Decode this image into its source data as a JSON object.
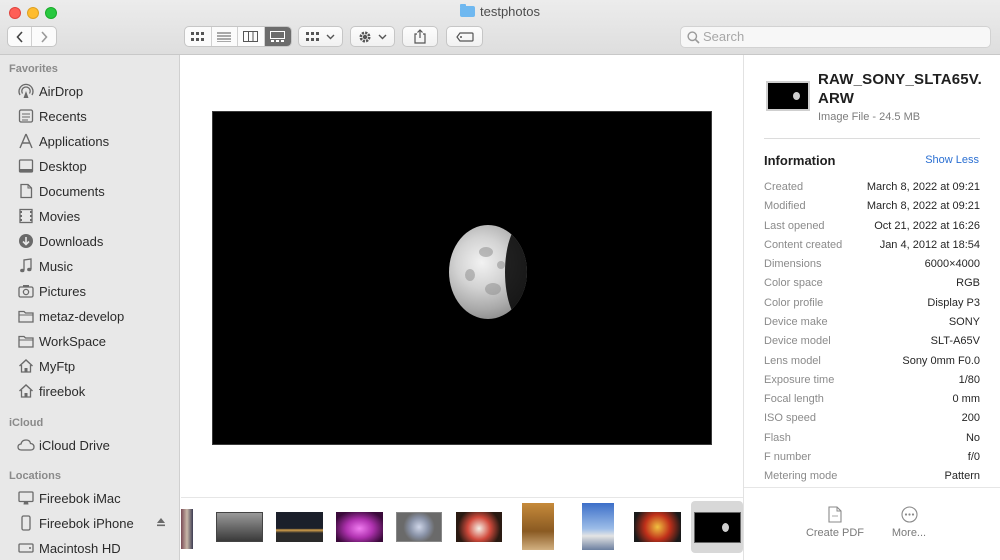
{
  "window": {
    "title": "testphotos"
  },
  "toolbar": {
    "search_placeholder": "Search"
  },
  "sidebar": {
    "favorites_label": "Favorites",
    "favorites": [
      {
        "label": "AirDrop",
        "icon": "airdrop-icon"
      },
      {
        "label": "Recents",
        "icon": "recents-icon"
      },
      {
        "label": "Applications",
        "icon": "applications-icon"
      },
      {
        "label": "Desktop",
        "icon": "desktop-icon"
      },
      {
        "label": "Documents",
        "icon": "documents-icon"
      },
      {
        "label": "Movies",
        "icon": "movies-icon"
      },
      {
        "label": "Downloads",
        "icon": "downloads-icon"
      },
      {
        "label": "Music",
        "icon": "music-icon"
      },
      {
        "label": "Pictures",
        "icon": "pictures-icon"
      },
      {
        "label": "metaz-develop",
        "icon": "folder-icon"
      },
      {
        "label": "WorkSpace",
        "icon": "folder-icon"
      },
      {
        "label": "MyFtp",
        "icon": "home-icon"
      },
      {
        "label": "fireebok",
        "icon": "home-icon"
      }
    ],
    "icloud_label": "iCloud",
    "icloud": [
      {
        "label": "iCloud Drive",
        "icon": "cloud-icon"
      }
    ],
    "locations_label": "Locations",
    "locations": [
      {
        "label": "Fireebok iMac",
        "icon": "imac-icon"
      },
      {
        "label": "Fireebok iPhone",
        "icon": "iphone-icon"
      },
      {
        "label": "Macintosh HD",
        "icon": "disk-icon"
      }
    ]
  },
  "inspector": {
    "filename": "RAW_SONY_SLTA65V.ARW",
    "kind_size": "Image File - 24.5 MB",
    "info_title": "Information",
    "show_less": "Show Less",
    "rows": [
      {
        "k": "Created",
        "v": "March 8, 2022 at 09:21"
      },
      {
        "k": "Modified",
        "v": "March 8, 2022 at 09:21"
      },
      {
        "k": "Last opened",
        "v": "Oct 21, 2022 at 16:26"
      },
      {
        "k": "Content created",
        "v": "Jan 4, 2012 at 18:54"
      },
      {
        "k": "Dimensions",
        "v": "6000×4000"
      },
      {
        "k": "Color space",
        "v": "RGB"
      },
      {
        "k": "Color profile",
        "v": "Display P3"
      },
      {
        "k": "Device make",
        "v": "SONY"
      },
      {
        "k": "Device model",
        "v": "SLT-A65V"
      },
      {
        "k": "Lens model",
        "v": "Sony 0mm F0.0"
      },
      {
        "k": "Exposure time",
        "v": "1/80"
      },
      {
        "k": "Focal length",
        "v": "0 mm"
      },
      {
        "k": "ISO speed",
        "v": "200"
      },
      {
        "k": "Flash",
        "v": "No"
      },
      {
        "k": "F number",
        "v": "f/0"
      },
      {
        "k": "Metering mode",
        "v": "Pattern"
      }
    ],
    "actions": [
      {
        "label": "Create PDF"
      },
      {
        "label": "More..."
      }
    ]
  }
}
